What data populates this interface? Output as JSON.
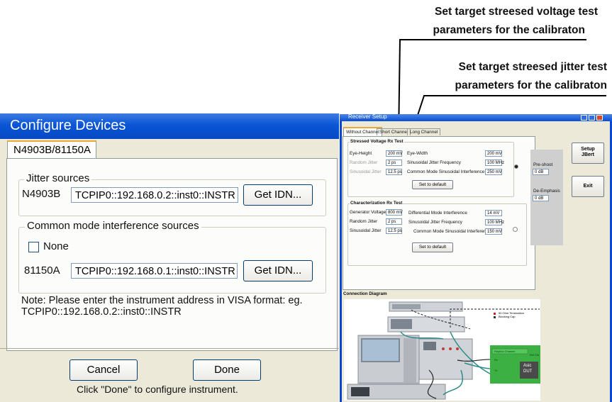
{
  "callouts": {
    "voltage_line1": "Set target streesed voltage test",
    "voltage_line2": "parameters for the calibraton",
    "jitter_line1": "Set target streesed jitter test",
    "jitter_line2": "parameters for the calibraton"
  },
  "configure": {
    "title": "Configure Devices",
    "tab": "N4903B/81150A",
    "jitter_group": "Jitter sources",
    "jitter_device": "N4903B",
    "jitter_address": "TCPIP0::192.168.0.2::inst0::INSTR",
    "get_idn": "Get IDN...",
    "cm_group": "Common mode interference sources",
    "none_label": "None",
    "cm_device": "81150A",
    "cm_address": "TCPIP0::192.168.0.1::inst0::INSTR",
    "note_line1": "Note: Please enter the instrument address in VISA format: eg.",
    "note_line2": "TCPIP0::192.168.0.2::inst0::INSTR",
    "cancel": "Cancel",
    "done": "Done",
    "hint": "Click \"Done\" to configure instrument."
  },
  "receiver": {
    "title": "Receiver Setup",
    "tabs": [
      "Without Channel",
      "Short Channel",
      "Long Channel"
    ],
    "stressed_voltage": {
      "heading": "Stressed Voltage Rx Test",
      "eye_height_label": "Eye-Height",
      "eye_height": "200 mV",
      "eye_width_label": "Eye-Width",
      "eye_width": "200 mV",
      "rj_label": "Random Jitter",
      "rj": "2 ps",
      "sj_freq_label": "Sinusoidal Jitter Frequency",
      "sj_freq": "100 MHz",
      "sj_label": "Sinusoidal Jitter",
      "sj": "12.5 ps",
      "cm_label": "Common Mode Sinusoidal Interference",
      "cm": "250 mV",
      "default_btn": "Set to default"
    },
    "characterization": {
      "heading": "Characterization Rx Test",
      "gen_v_label": "Generator Voltage",
      "gen_v": "800 mV",
      "dm_label": "Differential Mode Interference",
      "dm": "14 mV",
      "rj_label": "Random Jitter",
      "rj": "2 ps",
      "sj_freq_label": "Sinusoidal Jitter Frequency",
      "sj_freq": "100 MHz",
      "sj_label": "Sinusoidal Jitter",
      "sj": "12.5 ps",
      "cm_label": "Common Mode Sinusoidal Interference",
      "cm": "150 mV",
      "default_btn": "Set to default"
    },
    "preshoot_label": "Pre-shoot",
    "preshoot": "0 dB",
    "deemph_label": "De-Emphasis",
    "deemph": "0 dB",
    "setup_btn_line1": "Setup",
    "setup_btn_line2": "JBert",
    "exit_btn": "Exit",
    "diagram_title": "Connection Diagram",
    "legend_line1": "50 Ohm Termination",
    "legend_line2": "Blocking Cap",
    "replica_label": "Replica Channel",
    "ref_clk": "Ref Clk",
    "rx_label": "Rx",
    "tx_label": "Tx",
    "dut_line1": "Asic",
    "dut_line2": "DUT"
  }
}
